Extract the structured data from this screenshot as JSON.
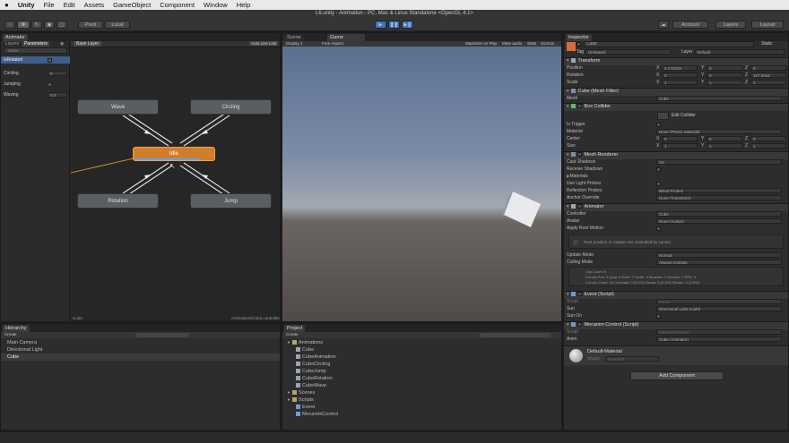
{
  "menubar": {
    "app": "Unity",
    "items": [
      "File",
      "Edit",
      "Assets",
      "GameObject",
      "Component",
      "Window",
      "Help"
    ]
  },
  "window_title": "L6.unity - Animation - PC, Mac & Linux Standalone <OpenGL 4.1>",
  "toolbar": {
    "pivot": "Pivot",
    "local": "Local",
    "account": "Account",
    "layers": "Layers",
    "layout": "Layout"
  },
  "animator": {
    "tab": "Animator",
    "subtabs": [
      "Layers",
      "Parameters"
    ],
    "search_placeholder": "Name",
    "layer_title": "Base Layer",
    "auto_live_link": "Auto Live Link",
    "parameters": [
      {
        "name": "isRotated",
        "value": ""
      },
      {
        "name": "Circling",
        "value": "0"
      },
      {
        "name": "Jumping",
        "value": ""
      },
      {
        "name": "Waving",
        "value": "0.0"
      }
    ],
    "states": {
      "wave": "Wave",
      "circling": "Circling",
      "idle": "Idle",
      "rotation": "Rotation",
      "jump": "Jump"
    },
    "footer_left": "Cube",
    "footer_right": "Animations/Cube.controller"
  },
  "game": {
    "tabs": [
      "Scene",
      "Game"
    ],
    "display": "Display 1",
    "aspect": "Free Aspect",
    "options": [
      "Maximize on Play",
      "Mute audio",
      "Stats",
      "Gizmos"
    ]
  },
  "hierarchy": {
    "tab": "Hierarchy",
    "create": "Create",
    "items": [
      "Main Camera",
      "Directional Light",
      "Cube"
    ]
  },
  "project": {
    "tab": "Project",
    "create": "Create",
    "items": [
      {
        "label": "Animations",
        "type": "folder",
        "depth": 0
      },
      {
        "label": "Cube",
        "type": "asset",
        "depth": 1
      },
      {
        "label": "CubeAnimation",
        "type": "asset",
        "depth": 1
      },
      {
        "label": "CubeCircling",
        "type": "asset",
        "depth": 1
      },
      {
        "label": "CubeJump",
        "type": "asset",
        "depth": 1
      },
      {
        "label": "CubeRotation",
        "type": "asset",
        "depth": 1
      },
      {
        "label": "CubeWave",
        "type": "asset",
        "depth": 1
      },
      {
        "label": "Scenes",
        "type": "folder",
        "depth": 0
      },
      {
        "label": "Scripts",
        "type": "folder",
        "depth": 0
      },
      {
        "label": "Event",
        "type": "script",
        "depth": 1
      },
      {
        "label": "MecanimControl",
        "type": "script",
        "depth": 1
      }
    ]
  },
  "inspector": {
    "tab": "Inspector",
    "object_name": "Cube",
    "static_label": "Static",
    "tag_label": "Tag",
    "tag_value": "Untagged",
    "layer_label": "Layer",
    "layer_value": "Default",
    "transform": {
      "title": "Transform",
      "position": {
        "label": "Position",
        "x": "4.171019",
        "y": "0",
        "z": "0"
      },
      "rotation": {
        "label": "Rotation",
        "x": "0",
        "y": "0",
        "z": "157.0054"
      },
      "scale": {
        "label": "Scale",
        "x": "1",
        "y": "1",
        "z": "1"
      }
    },
    "mesh_filter": {
      "title": "Cube (Mesh Filter)",
      "mesh_label": "Mesh",
      "mesh_value": "Cube"
    },
    "box_collider": {
      "title": "Box Collider",
      "edit": "Edit Collider",
      "is_trigger": "Is Trigger",
      "material_label": "Material",
      "material_value": "None (Physic Material)",
      "center": {
        "label": "Center",
        "x": "0",
        "y": "0",
        "z": "0"
      },
      "size": {
        "label": "Size",
        "x": "1",
        "y": "1",
        "z": "1"
      }
    },
    "mesh_renderer": {
      "title": "Mesh Renderer",
      "cast_shadows": "Cast Shadows",
      "cast_shadows_value": "On",
      "receive_shadows": "Receive Shadows",
      "materials": "Materials",
      "use_light_probes": "Use Light Probes",
      "reflection_probes": "Reflection Probes",
      "reflection_probes_value": "Blend Probes",
      "anchor_override": "Anchor Override",
      "anchor_override_value": "None (Transform)"
    },
    "animator_comp": {
      "title": "Animator",
      "controller_label": "Controller",
      "controller_value": "Cube",
      "avatar_label": "Avatar",
      "avatar_value": "None (Avatar)",
      "apply_root_motion": "Apply Root Motion",
      "info": "Root position or rotation are controlled by curves",
      "update_mode_label": "Update Mode",
      "update_mode_value": "Normal",
      "culling_mode_label": "Culling Mode",
      "culling_mode_value": "Always Animate",
      "clip_count": "Clip Count: 5",
      "curves_pos": "Curves Pos: 4 Quat: 0 Euler: 2 Scale: 4 Muscles: 0 Generic: 0 PPtr: 0",
      "curves_count": "Curves Count: 18 Constant: 0 (0.0%) Dense: 8 (0.0%) Stream: 0 (0.0%)"
    },
    "event_script": {
      "title": "Event (Script)",
      "script_label": "Script",
      "script_value": "Event",
      "sun_label": "Sun",
      "sun_value": "Directional Light (Light)",
      "sunon_label": "Sun On"
    },
    "mecanim_script": {
      "title": "Mecanim Control (Script)",
      "script_label": "Script",
      "script_value": "MecanimControl",
      "anim_label": "Anim",
      "anim_value": "Cube (Animator)"
    },
    "material": {
      "name": "Default-Material",
      "shader_label": "Shader",
      "shader_value": "Standard"
    },
    "add_component": "Add Component"
  }
}
